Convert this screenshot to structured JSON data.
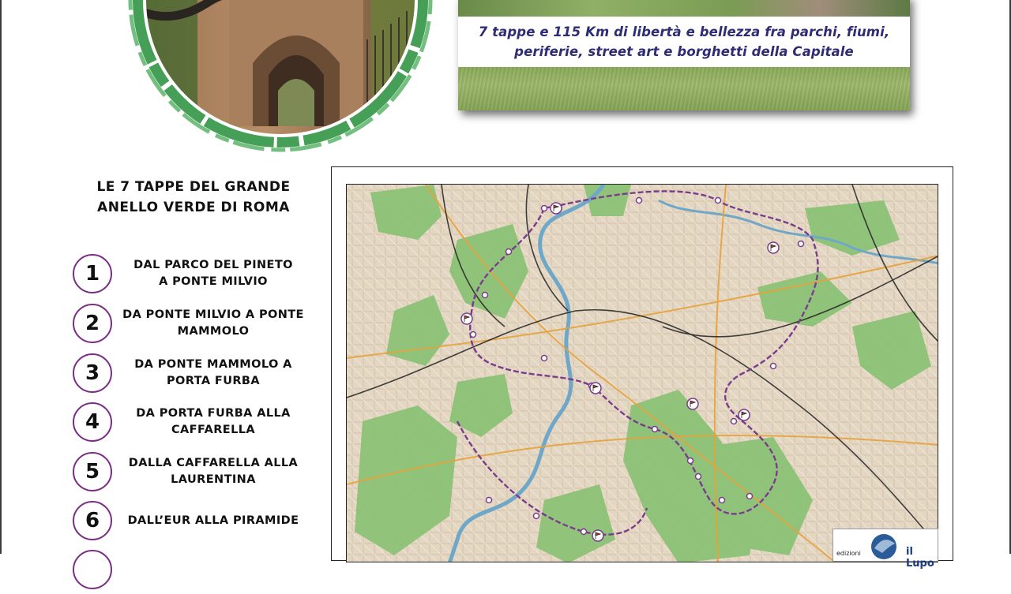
{
  "banner": {
    "caption_line1": "7 tappe e 115 Km di libertà e bellezza fra parchi, fiumi,",
    "caption_line2": "periferie, street art e borghetti della Capitale"
  },
  "list": {
    "title_line1": "LE 7 TAPPE DEL GRANDE",
    "title_line2": "ANELLO VERDE DI ROMA",
    "stages": [
      {
        "number": "1",
        "line1": "DAL PARCO DEL PINETO",
        "line2": "A PONTE MILVIO"
      },
      {
        "number": "2",
        "line1": "DA PONTE MILVIO A PONTE",
        "line2": "MAMMOLO"
      },
      {
        "number": "3",
        "line1": "DA PONTE MAMMOLO A",
        "line2": "PORTA FURBA"
      },
      {
        "number": "4",
        "line1": "DA PORTA FURBA ALLA",
        "line2": "CAFFARELLA"
      },
      {
        "number": "5",
        "line1": "DALLA CAFFARELLA ALLA",
        "line2": "LAURENTINA"
      },
      {
        "number": "6",
        "line1": "DALL’EUR ALLA PIRAMIDE",
        "line2": ""
      }
    ]
  },
  "map": {
    "publisher_small": "edizioni",
    "publisher_name": "il Lupo"
  },
  "colors": {
    "stage_ring": "#7b2d86",
    "caption_text": "#2e2c74",
    "ring_green": "#3c9a4e",
    "park_green": "#8cc277",
    "route_purple": "#7a3c8c",
    "river_blue": "#6fa7c9"
  },
  "icons": [
    "stage-flag-icon",
    "route-waypoint-icon",
    "publisher-logo-icon"
  ]
}
